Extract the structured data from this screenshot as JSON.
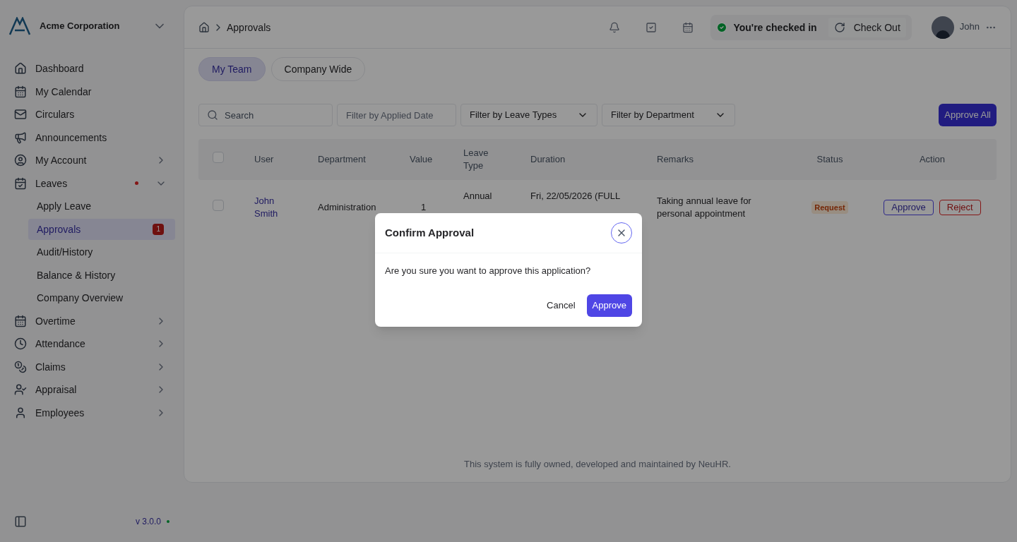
{
  "sidebar": {
    "company": "Acme Corporation",
    "items": [
      {
        "label": "Dashboard",
        "expandable": false,
        "dot": false
      },
      {
        "label": "My Calendar",
        "expandable": false,
        "dot": false
      },
      {
        "label": "Circulars",
        "expandable": false,
        "dot": false
      },
      {
        "label": "Announcements",
        "expandable": false,
        "dot": false
      },
      {
        "label": "My Account",
        "expandable": true,
        "expanded": false,
        "dot": false
      },
      {
        "label": "Leaves",
        "expandable": true,
        "expanded": true,
        "dot": true,
        "children": [
          {
            "label": "Apply Leave",
            "selected": false
          },
          {
            "label": "Approvals",
            "selected": true,
            "badge": "1"
          },
          {
            "label": "Audit/History",
            "selected": false
          },
          {
            "label": "Balance & History",
            "selected": false
          },
          {
            "label": "Company Overview",
            "selected": false
          }
        ]
      },
      {
        "label": "Overtime",
        "expandable": true,
        "expanded": false,
        "dot": false
      },
      {
        "label": "Attendance",
        "expandable": true,
        "expanded": false,
        "dot": false
      },
      {
        "label": "Claims",
        "expandable": true,
        "expanded": false,
        "dot": false
      },
      {
        "label": "Appraisal",
        "expandable": true,
        "expanded": false,
        "dot": false
      },
      {
        "label": "Employees",
        "expandable": true,
        "expanded": false,
        "dot": false
      }
    ],
    "version": "v 3.0.0"
  },
  "header": {
    "breadcrumb": "Approvals",
    "checkin_status": "You're checked in",
    "check_out": "Check Out",
    "user": "John"
  },
  "tabs": [
    {
      "label": "My Team",
      "selected": true
    },
    {
      "label": "Company Wide",
      "selected": false
    }
  ],
  "filters": {
    "search": {
      "placeholder": "Search"
    },
    "date": {
      "placeholder": "Filter by Applied Date"
    },
    "leave_types": "Filter by Leave Types",
    "department": "Filter by Department",
    "approve_all": "Approve All"
  },
  "table": {
    "header_checked": false,
    "columns": [
      "User",
      "Department",
      "Value",
      "Leave Type",
      "Duration",
      "Remarks",
      "Status",
      "Action"
    ],
    "rows": [
      {
        "checked": false,
        "user": "John Smith",
        "department": "Administration",
        "value": "1",
        "leave_type": "Annual",
        "duration": "Fri, 22/05/2026 (FULL",
        "remarks": "Taking annual leave for personal appointment",
        "status": "Request",
        "actions": [
          "Approve",
          "Reject"
        ]
      }
    ]
  },
  "footer": "This system is fully owned, developed and maintained by NeuHR.",
  "modal": {
    "title": "Confirm Approval",
    "message": "Are you sure you want to approve this application?",
    "buttons": [
      "Cancel",
      "Approve"
    ]
  }
}
